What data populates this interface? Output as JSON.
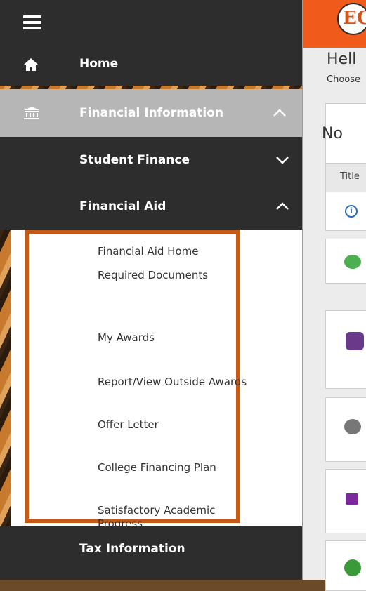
{
  "header": {
    "logo_text": "EC"
  },
  "main": {
    "greeting": "Hell",
    "subtitle": "Choose",
    "card_title": "No",
    "table_header": "Title",
    "info_icon": "info-icon"
  },
  "sidebar": {
    "menu_icon": "hamburger-icon",
    "items": [
      {
        "label": "Home",
        "icon": "home-icon"
      },
      {
        "label": "Financial Information",
        "icon": "bank-icon",
        "expanded": true
      },
      {
        "label": "Student Finance",
        "expanded": false
      },
      {
        "label": "Financial Aid",
        "expanded": true
      },
      {
        "label": "Tax Information"
      }
    ],
    "financial_aid_subitems": [
      "Financial Aid Home",
      "Required Documents",
      "My Awards",
      "Report/View Outside Awards",
      "Offer Letter",
      "College Financing Plan",
      "Satisfactory Academic Progress"
    ]
  },
  "colors": {
    "sidebar_dark": "#2d2d2d",
    "sidebar_active": "#b6b6b6",
    "highlight_box": "#c55a17",
    "brand_orange": "#f05a1a"
  }
}
